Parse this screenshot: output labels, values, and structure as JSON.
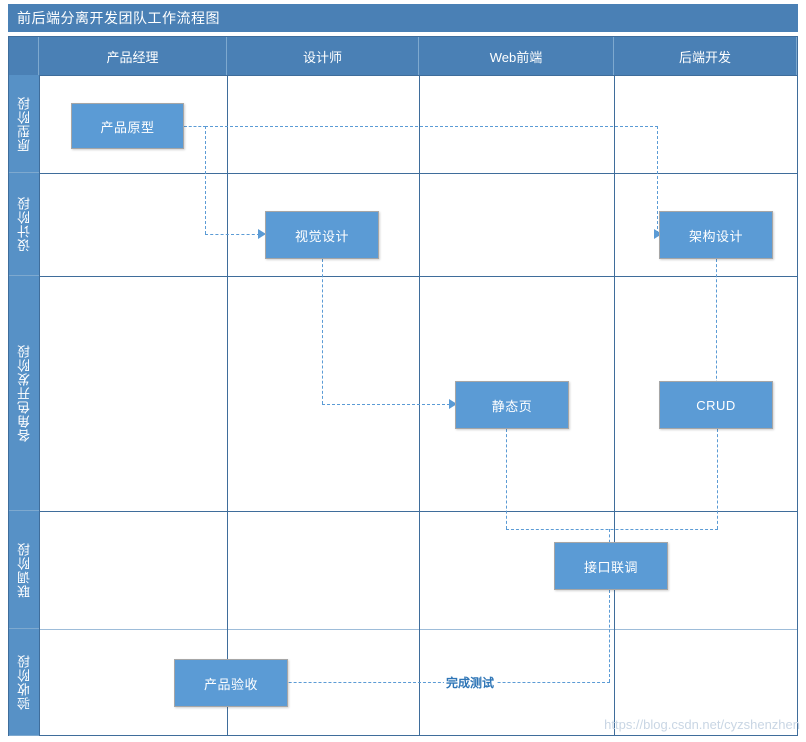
{
  "diagram": {
    "title": "前后端分离开发团队工作流程图",
    "watermark": "https://blog.csdn.net/cyzshenzhen",
    "colors": {
      "title_bar": "#4a80b5",
      "header": "#4a80b5",
      "row_label": "#5791c6",
      "node_fill": "#5b9bd5",
      "connector": "#5b9bd5",
      "grid": "#3f6d9b",
      "edge_label_text": "#2e75b6"
    },
    "columns": [
      {
        "label": "产品经理"
      },
      {
        "label": "设计师"
      },
      {
        "label": "Web前端"
      },
      {
        "label": "后端开发"
      }
    ],
    "rows": [
      {
        "label": "原型阶段"
      },
      {
        "label": "设计阶段"
      },
      {
        "label": "各角色开发阶段"
      },
      {
        "label": "联调阶段"
      },
      {
        "label": "验收阶段"
      }
    ],
    "nodes": [
      {
        "id": "prototype",
        "label": "产品原型",
        "column": "产品经理",
        "row": "原型阶段"
      },
      {
        "id": "visual",
        "label": "视觉设计",
        "column": "设计师",
        "row": "设计阶段"
      },
      {
        "id": "architecture",
        "label": "架构设计",
        "column": "后端开发",
        "row": "设计阶段"
      },
      {
        "id": "static-page",
        "label": "静态页",
        "column": "Web前端",
        "row": "各角色开发阶段"
      },
      {
        "id": "crud",
        "label": "CRUD",
        "column": "后端开发",
        "row": "各角色开发阶段"
      },
      {
        "id": "integration",
        "label": "接口联调",
        "column": "Web前端",
        "row": "联调阶段"
      },
      {
        "id": "acceptance",
        "label": "产品验收",
        "column": "产品经理",
        "row": "验收阶段"
      }
    ],
    "edges": [
      {
        "from": "prototype",
        "to": "visual",
        "label": ""
      },
      {
        "from": "prototype",
        "to": "architecture",
        "label": ""
      },
      {
        "from": "visual",
        "to": "static-page",
        "label": ""
      },
      {
        "from": "architecture",
        "to": "crud",
        "label": ""
      },
      {
        "from": "static-page",
        "to": "integration",
        "label": ""
      },
      {
        "from": "crud",
        "to": "integration",
        "label": ""
      },
      {
        "from": "integration",
        "to": "acceptance",
        "label": "完成测试"
      }
    ],
    "edge_labels": {
      "test_complete": "完成测试"
    }
  }
}
